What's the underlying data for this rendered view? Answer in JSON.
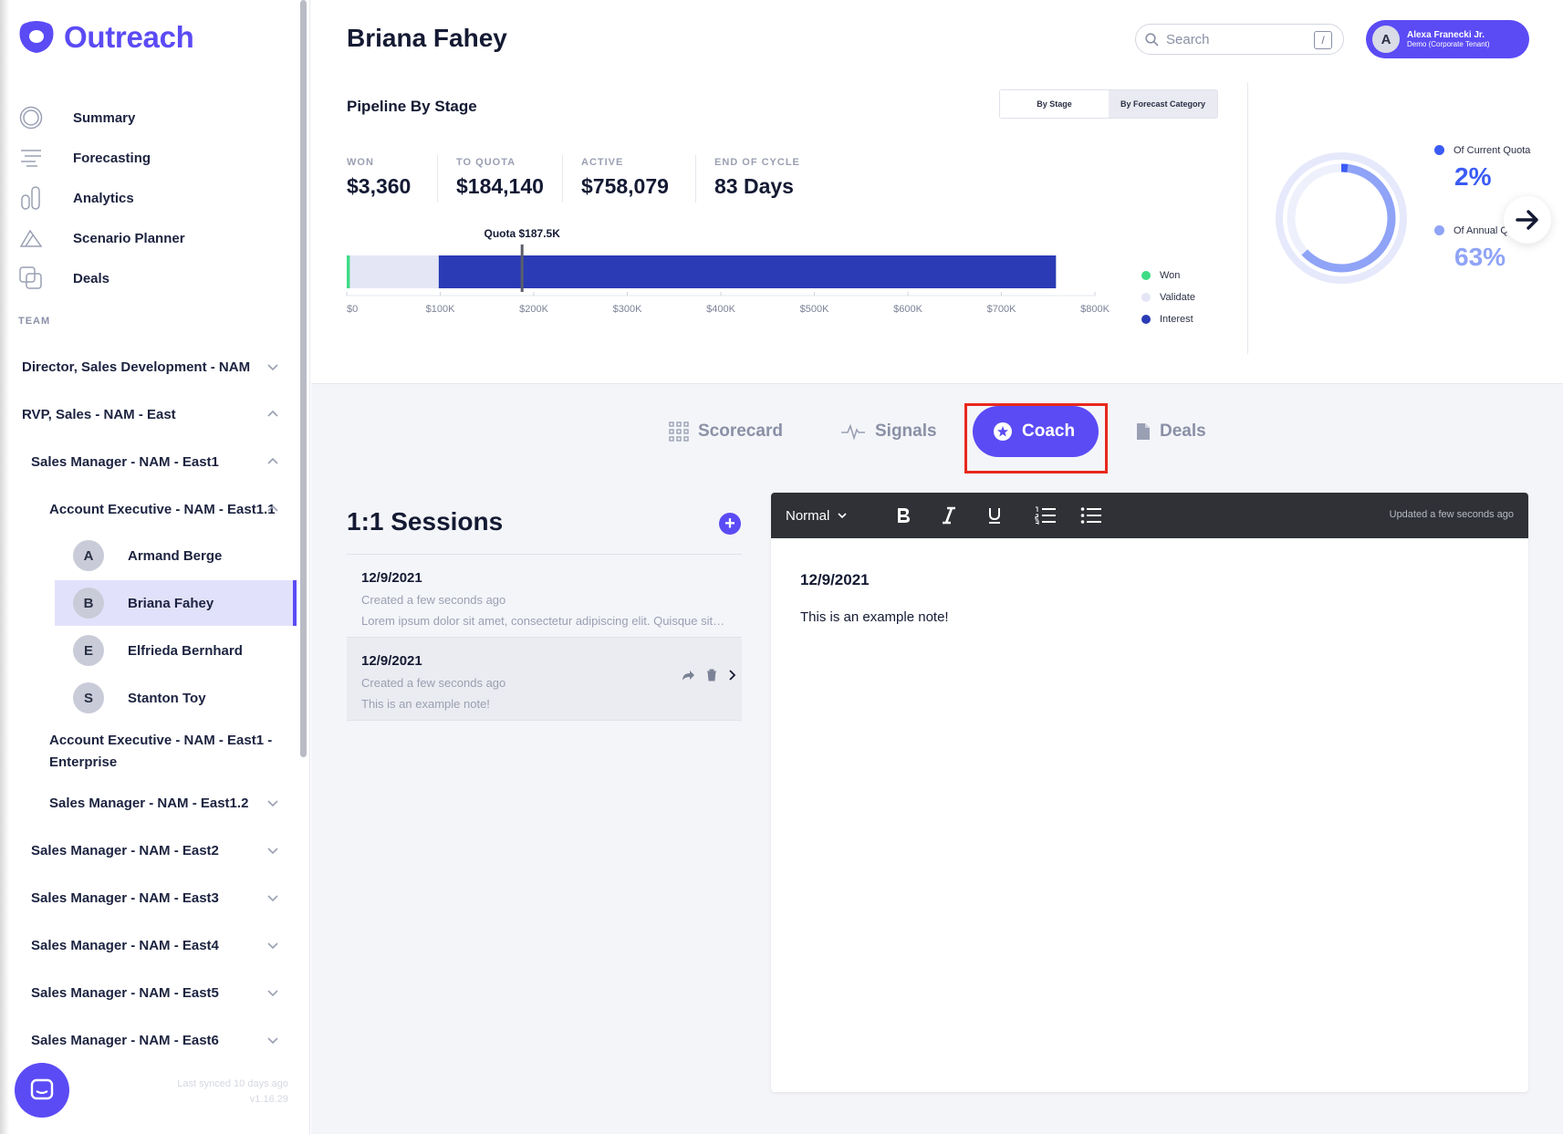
{
  "brand": {
    "name": "Outreach"
  },
  "nav": [
    {
      "label": "Summary",
      "icon": "summary-icon"
    },
    {
      "label": "Forecasting",
      "icon": "forecasting-icon"
    },
    {
      "label": "Analytics",
      "icon": "analytics-icon"
    },
    {
      "label": "Scenario Planner",
      "icon": "scenario-planner-icon"
    },
    {
      "label": "Deals",
      "icon": "deals-icon"
    }
  ],
  "team": {
    "label": "TEAM",
    "rows": [
      {
        "label": "Director, Sales Development - NAM",
        "expanded": false
      },
      {
        "label": "RVP, Sales - NAM - East",
        "expanded": true
      },
      {
        "label": "Sales Manager - NAM - East1",
        "expanded": true
      },
      {
        "label": "Account Executive - NAM - East1.1",
        "expanded": true
      },
      {
        "label": "Account Executive - NAM - East1 -",
        "label2": "Enterprise"
      },
      {
        "label": "Sales Manager - NAM - East1.2",
        "expanded": false
      },
      {
        "label": "Sales Manager - NAM - East2",
        "expanded": false
      },
      {
        "label": "Sales Manager - NAM - East3",
        "expanded": false
      },
      {
        "label": "Sales Manager - NAM - East4",
        "expanded": false
      },
      {
        "label": "Sales Manager - NAM - East5",
        "expanded": false
      },
      {
        "label": "Sales Manager - NAM - East6",
        "expanded": false
      }
    ],
    "people": [
      {
        "initial": "A",
        "name": "Armand Berge"
      },
      {
        "initial": "B",
        "name": "Briana Fahey",
        "active": true
      },
      {
        "initial": "E",
        "name": "Elfrieda Bernhard"
      },
      {
        "initial": "S",
        "name": "Stanton Toy"
      }
    ]
  },
  "footer": {
    "synced": "Last synced 10 days ago",
    "version": "v1.16.29"
  },
  "header": {
    "title": "Briana Fahey",
    "search_placeholder": "Search",
    "search_shortcut": "/",
    "user": {
      "initial": "A",
      "name": "Alexa Franecki Jr.",
      "tenant": "Demo (Corporate Tenant)"
    }
  },
  "pipeline": {
    "title": "Pipeline By Stage",
    "toggle": [
      "By Stage",
      "By Forecast Category"
    ],
    "toggle_selected": "By Stage",
    "stats": [
      {
        "label": "WON",
        "value": "$3,360"
      },
      {
        "label": "TO QUOTA",
        "value": "$184,140"
      },
      {
        "label": "ACTIVE",
        "value": "$758,079"
      },
      {
        "label": "END OF CYCLE",
        "value": "83 Days"
      }
    ]
  },
  "chart_data": {
    "type": "bar",
    "orientation": "horizontal-stacked",
    "title": "",
    "ticks": [
      "$0",
      "$100K",
      "$200K",
      "$300K",
      "$400K",
      "$500K",
      "$600K",
      "$700K",
      "$800K"
    ],
    "xlim": [
      0,
      800000
    ],
    "quota": {
      "label": "Quota $187.5K",
      "value": 187500
    },
    "series": [
      {
        "name": "Won",
        "value": 3360,
        "color": "#3ddc84"
      },
      {
        "name": "Validate",
        "value": 95000,
        "color": "#e4e6f5"
      },
      {
        "name": "Interest",
        "value": 660000,
        "color": "#2a3bb5"
      }
    ],
    "legend": "right"
  },
  "quota_card": {
    "current": {
      "label": "Of Current Quota",
      "value": "2%",
      "fraction": 0.02,
      "color": "#3b5bf5"
    },
    "annual": {
      "label": "Of Annual Quota",
      "value": "63%",
      "fraction": 0.63,
      "color": "#8fa3f7"
    }
  },
  "tabs": [
    {
      "label": "Scorecard",
      "icon": "scorecard-icon"
    },
    {
      "label": "Signals",
      "icon": "signals-icon"
    },
    {
      "label": "Coach",
      "icon": "coach-icon",
      "active": true
    },
    {
      "label": "Deals",
      "icon": "document-icon"
    }
  ],
  "sessions": {
    "title": "1:1 Sessions",
    "items": [
      {
        "date": "12/9/2021",
        "meta": "Created a few seconds ago",
        "preview": "Lorem ipsum dolor sit amet, consectetur adipiscing elit. Quisque sit amet"
      },
      {
        "date": "12/9/2021",
        "meta": "Created a few seconds ago",
        "preview": "This is an example note!"
      }
    ]
  },
  "editor": {
    "format": "Normal",
    "updated": "Updated a few seconds ago",
    "date": "12/9/2021",
    "text": "This is an example note!"
  },
  "colors": {
    "accent": "#5b4bf5",
    "highlight": "#e8281c"
  }
}
